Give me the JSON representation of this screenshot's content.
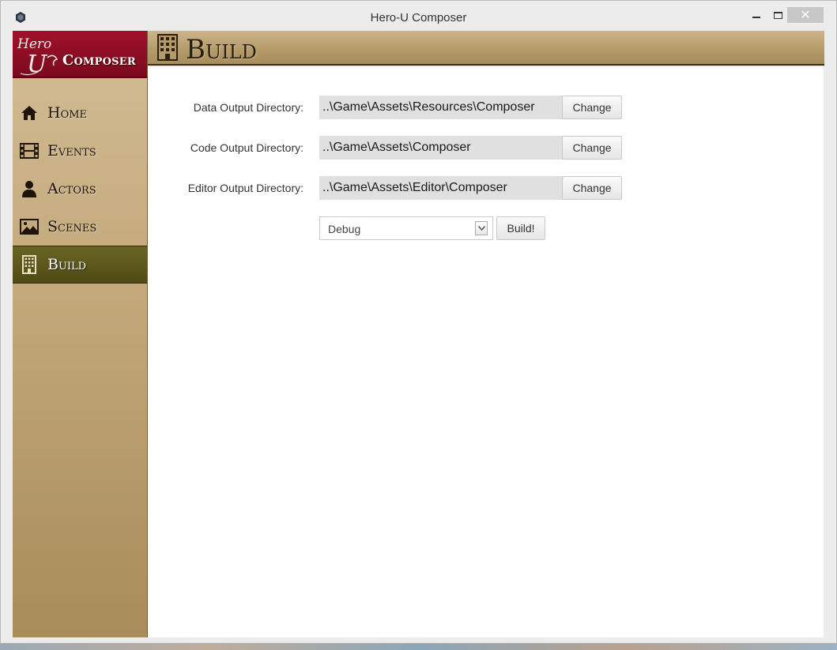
{
  "window": {
    "title": "Hero-U Composer",
    "minimize_label": "",
    "maximize_label": "",
    "close_label": "✕"
  },
  "logo": {
    "mark_line1": "Hero",
    "mark_line2": "U",
    "text": "Composer"
  },
  "sidebar": {
    "items": [
      {
        "label": "Home",
        "icon": "home-icon"
      },
      {
        "label": "Events",
        "icon": "film-icon"
      },
      {
        "label": "Actors",
        "icon": "person-icon"
      },
      {
        "label": "Scenes",
        "icon": "picture-icon"
      },
      {
        "label": "Build",
        "icon": "building-icon",
        "active": true
      }
    ]
  },
  "header": {
    "title": "Build",
    "icon": "building-icon"
  },
  "form": {
    "rows": [
      {
        "label": "Data Output Directory:",
        "value": "..\\Game\\Assets\\Resources\\Composer",
        "button": "Change"
      },
      {
        "label": "Code Output Directory:",
        "value": "..\\Game\\Assets\\Composer",
        "button": "Change"
      },
      {
        "label": "Editor Output Directory:",
        "value": "..\\Game\\Assets\\Editor\\Composer",
        "button": "Change"
      }
    ],
    "config_select": {
      "selected": "Debug"
    },
    "build_button": "Build!"
  },
  "colors": {
    "logo_bg": "#8a0c22",
    "sidebar_bg": "#c4aa7c",
    "active_nav": "#5a5419",
    "header_bg": "#b39a68"
  }
}
